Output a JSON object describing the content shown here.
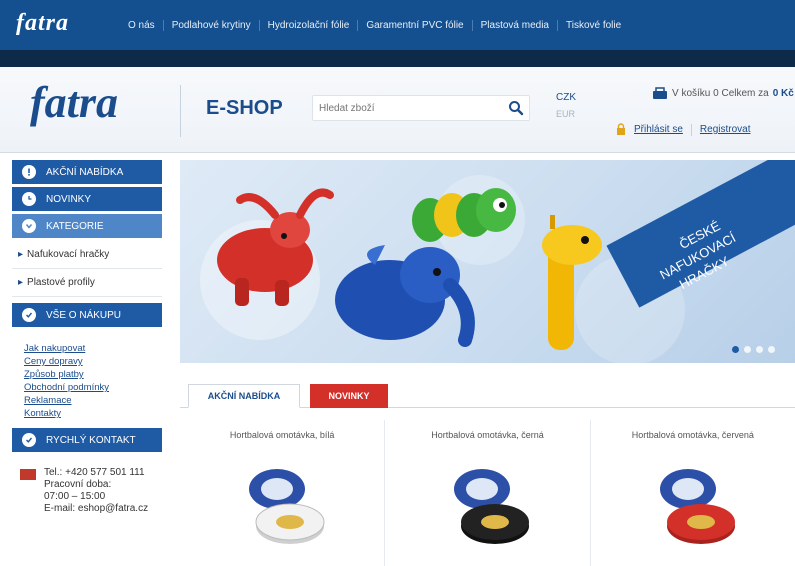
{
  "topnav": {
    "brand": "fatra",
    "links": [
      "O nás",
      "Podlahové krytiny",
      "Hydroizolační fólie",
      "Garamentní PVC fólie",
      "Plastová media",
      "Tiskové folie"
    ]
  },
  "header": {
    "logo": "fatra",
    "eshop": "E-SHOP",
    "search_placeholder": "Hledat zboží",
    "currency": "CZK",
    "currency_sub": "EUR",
    "cart_text": "V košíku 0 Celkem za",
    "cart_total": "0 Kč",
    "login": "Přihlásit se",
    "register": "Registrovat"
  },
  "sidebar": {
    "akcni": "Akční nabídka",
    "novinky": "Novinky",
    "kategorie": "Kategorie",
    "categories": [
      "Nafukovací hračky",
      "Plastové profily"
    ],
    "vse": "Vše o nákupu",
    "vse_links": [
      "Jak nakupovat",
      "Ceny dopravy",
      "Způsob platby",
      "Obchodní podmínky",
      "Reklamace",
      "Kontakty"
    ],
    "kontakt": "Rychlý kontakt",
    "kontakt_lines": [
      "Tel.: +420 577 501 111",
      "Pracovní doba:",
      "07:00 – 15:00",
      "E-mail: eshop@fatra.cz"
    ]
  },
  "banner": {
    "text_lines": [
      "ČESKÉ",
      "NAFUKOVACÍ",
      "HRAČKY"
    ],
    "accent": "#1f5ba5"
  },
  "tabs": {
    "active": "Akční nabídka",
    "second": "Novinky"
  },
  "products": [
    {
      "name": "Hortbalová omotávka, bílá",
      "tape_color": "#f2f2f2"
    },
    {
      "name": "Hortbalová omotávka, černá",
      "tape_color": "#222222"
    },
    {
      "name": "Hortbalová omotávka, červená",
      "tape_color": "#d3302a"
    }
  ],
  "colors": {
    "primary": "#14508f",
    "dark": "#0e2a49",
    "red": "#d3302a"
  }
}
